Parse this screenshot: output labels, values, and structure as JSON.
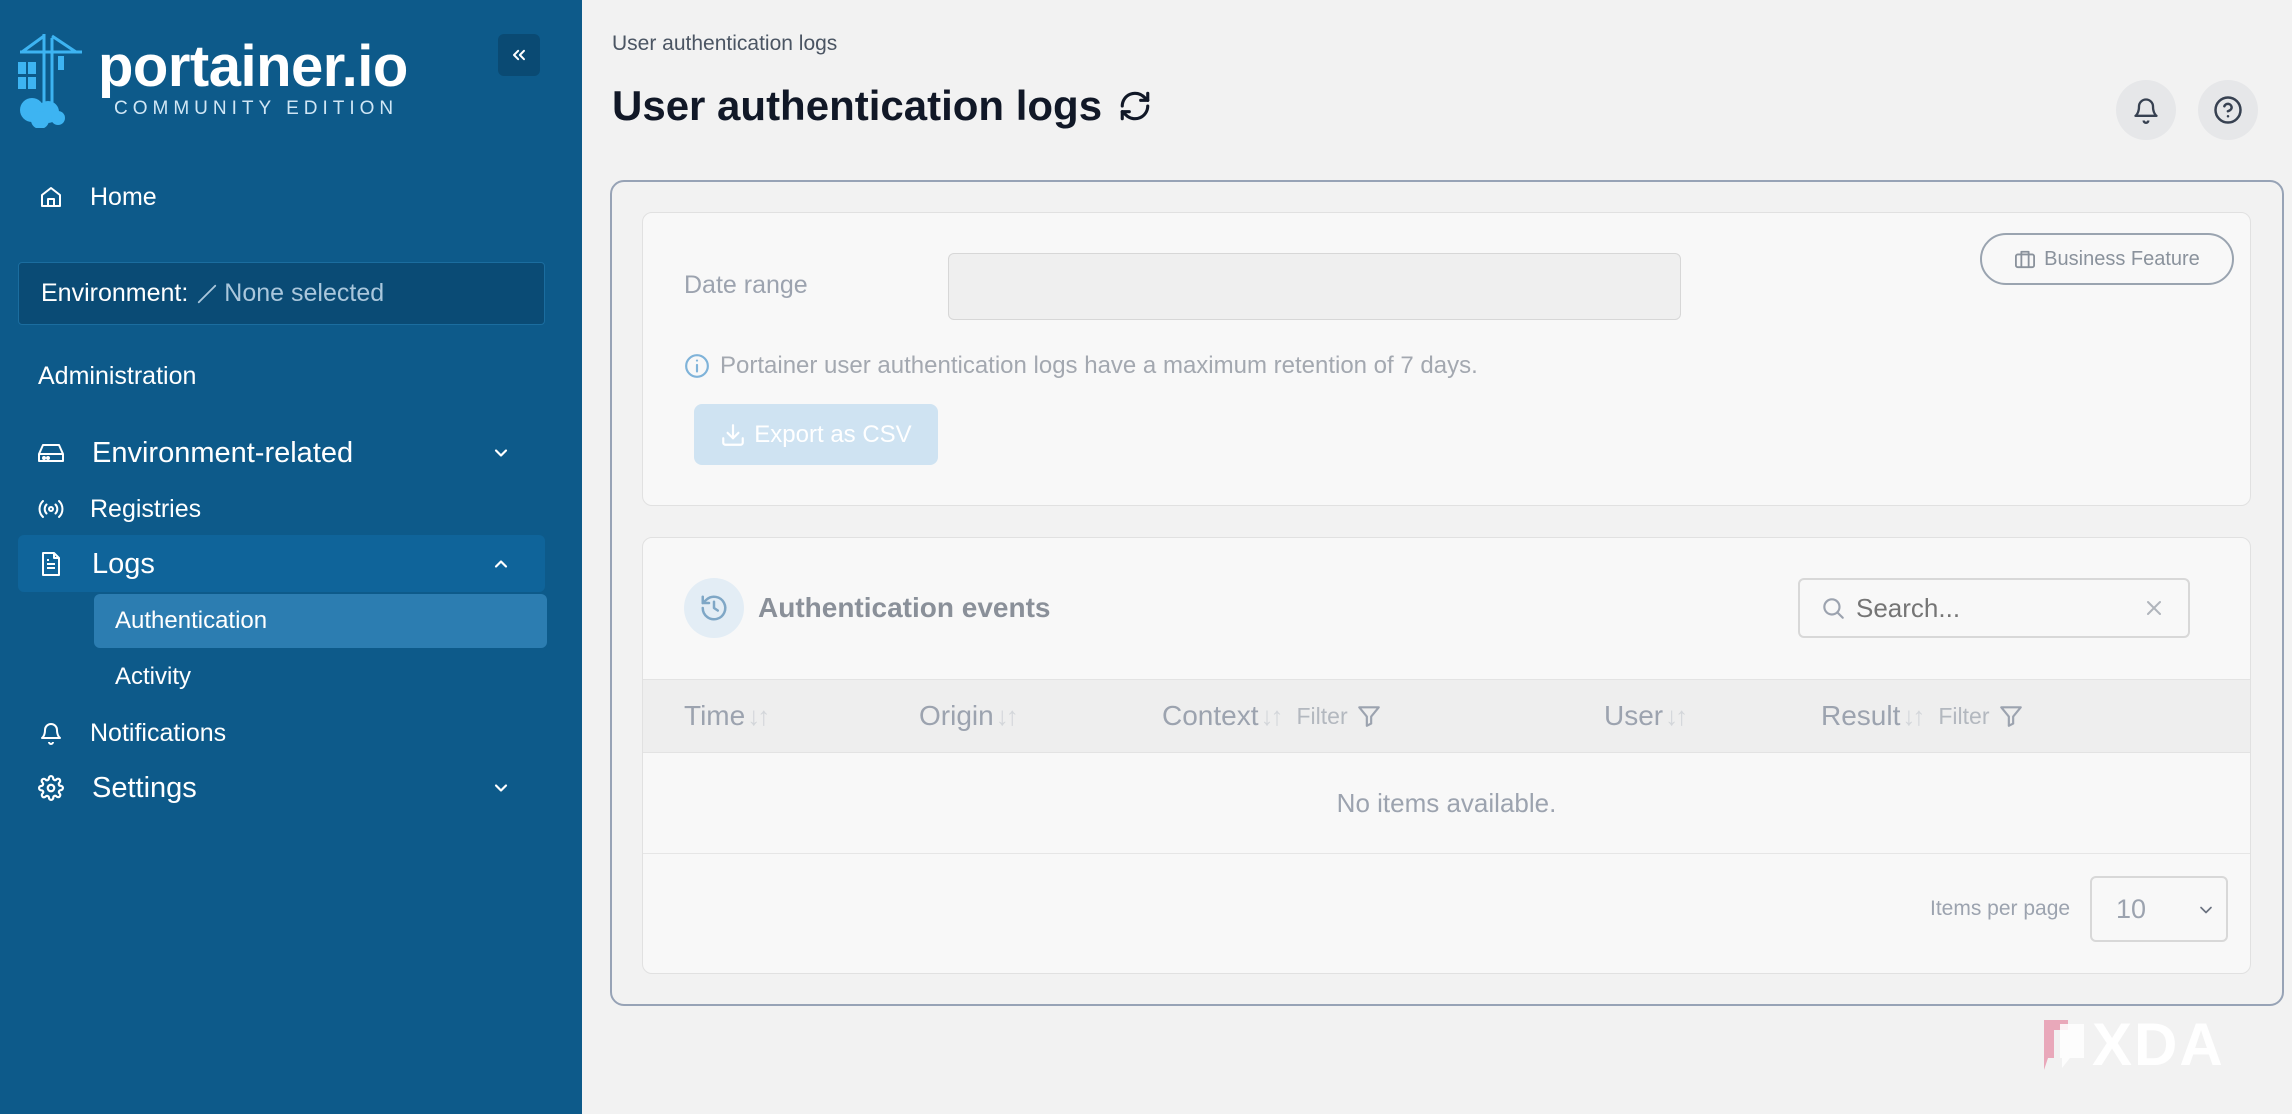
{
  "sidebar": {
    "logo": {
      "title": "portainer.io",
      "subtitle": "COMMUNITY EDITION"
    },
    "home_label": "Home",
    "environment": {
      "label": "Environment:",
      "value": "None selected"
    },
    "section_title": "Administration",
    "items": [
      {
        "label": "Environment-related",
        "icon": "drive-icon",
        "expanded": false
      },
      {
        "label": "Registries",
        "icon": "broadcast-icon"
      },
      {
        "label": "Logs",
        "icon": "file-icon",
        "expanded": true,
        "children": [
          "Authentication",
          "Activity"
        ]
      },
      {
        "label": "Notifications",
        "icon": "bell-icon"
      },
      {
        "label": "Settings",
        "icon": "gear-icon",
        "expanded": false
      }
    ]
  },
  "header": {
    "breadcrumb": "User authentication logs",
    "title": "User authentication logs"
  },
  "filters": {
    "business_feature": "Business Feature",
    "date_range_label": "Date range",
    "date_range_value": "",
    "info": "Portainer user authentication logs have a maximum retention of 7 days.",
    "export_label": "Export as CSV"
  },
  "events": {
    "title": "Authentication events",
    "search_placeholder": "Search...",
    "columns": [
      "Time",
      "Origin",
      "Context",
      "User",
      "Result"
    ],
    "filter_label": "Filter",
    "empty_text": "No items available.",
    "items_per_page_label": "Items per page",
    "items_per_page_value": "10"
  },
  "watermark": "XDA",
  "colors": {
    "sidebar": "#0d5a8a",
    "active_item": "#2c7db1",
    "page_bg": "#f2f2f2"
  }
}
